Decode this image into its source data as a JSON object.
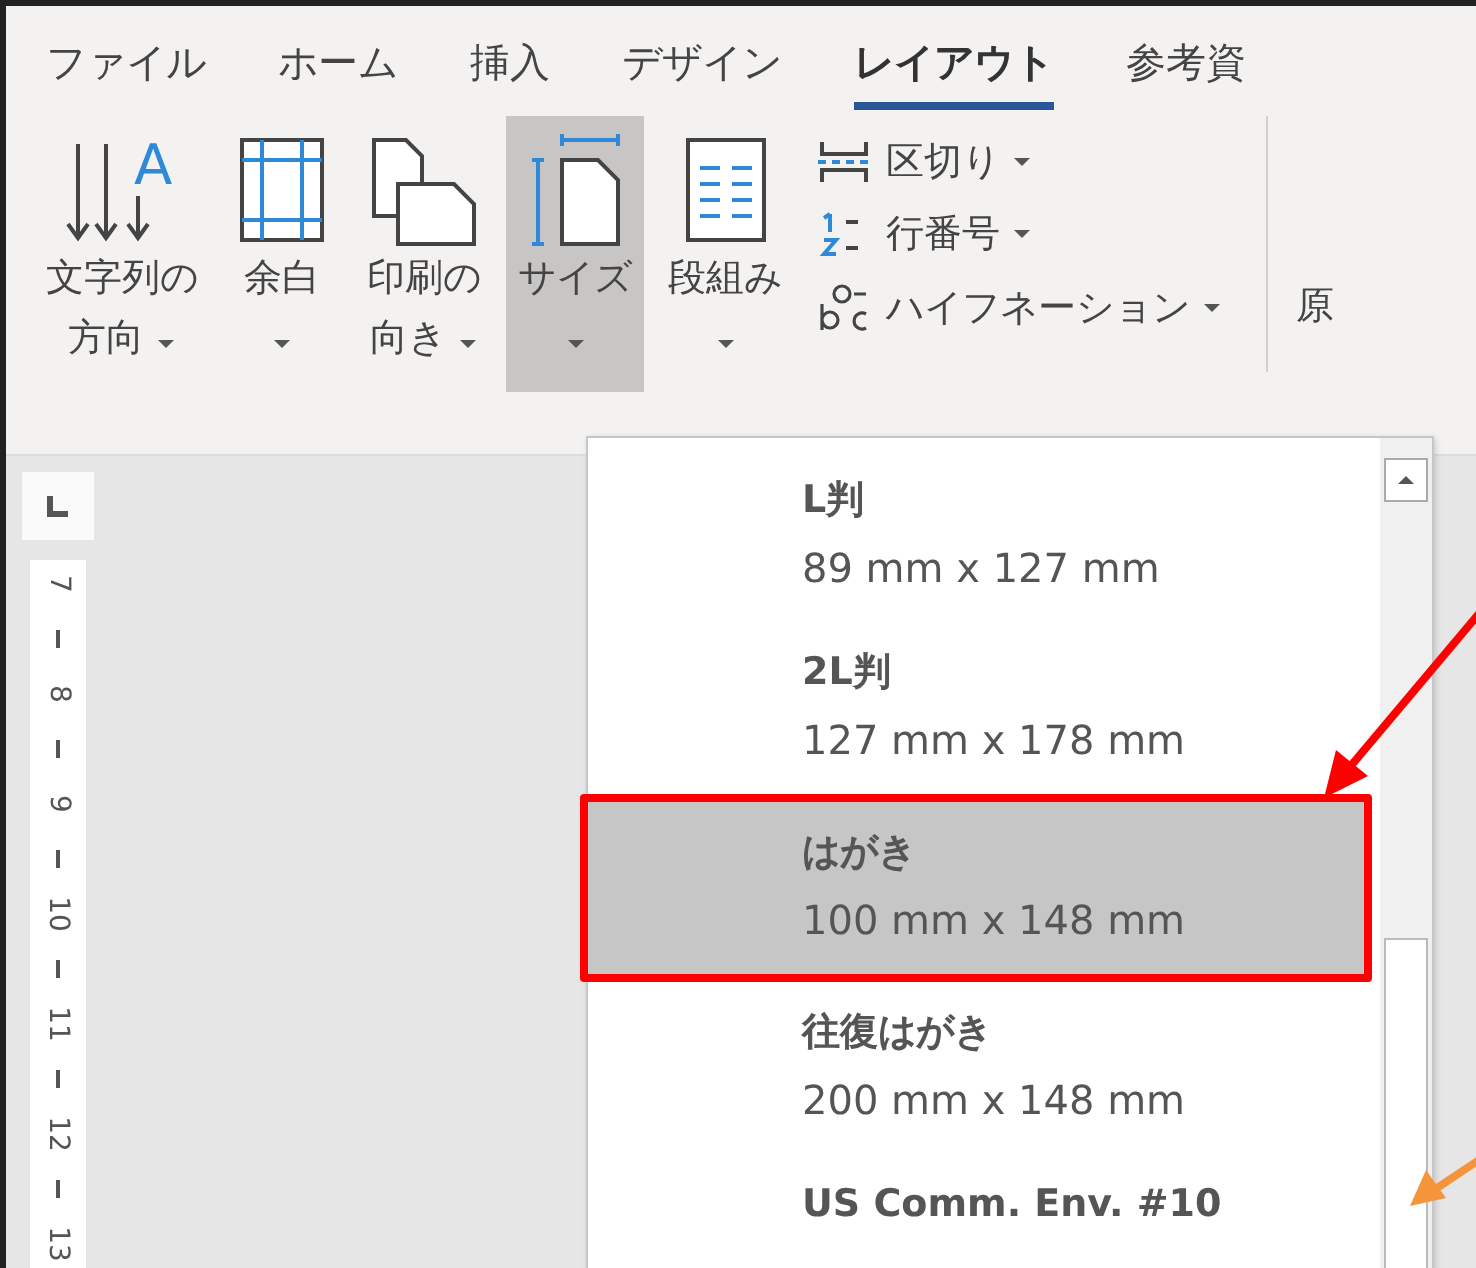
{
  "tabs": [
    {
      "label": "ファイル",
      "selected": false
    },
    {
      "label": "ホーム",
      "selected": false
    },
    {
      "label": "挿入",
      "selected": false
    },
    {
      "label": "デザイン",
      "selected": false
    },
    {
      "label": "レイアウト",
      "selected": true
    },
    {
      "label": "参考資",
      "selected": false
    }
  ],
  "ribbon": {
    "large_buttons": [
      {
        "kind": "text-direction",
        "icon_letter": "A",
        "lines": [
          "文字列の",
          "方向"
        ],
        "expanded": false
      },
      {
        "kind": "margins",
        "lines": [
          "余白"
        ],
        "expanded": false
      },
      {
        "kind": "orientation",
        "lines": [
          "印刷の",
          "向き"
        ],
        "expanded": false
      },
      {
        "kind": "size",
        "lines": [
          "サイズ"
        ],
        "expanded": true
      },
      {
        "kind": "columns",
        "lines": [
          "段組み"
        ],
        "expanded": false
      }
    ],
    "small_buttons": [
      {
        "kind": "breaks",
        "label": "区切り"
      },
      {
        "kind": "line-numbers",
        "label": "行番号"
      },
      {
        "kind": "hyphenation",
        "label": "ハイフネーション"
      }
    ],
    "next_group_label": "原"
  },
  "ruler": {
    "numbers": [
      "7",
      "8",
      "9",
      "10",
      "11",
      "12",
      "13"
    ]
  },
  "size_menu": {
    "items": [
      {
        "name": "L判",
        "dimensions": "89 mm x 127 mm",
        "selected": false
      },
      {
        "name": "2L判",
        "dimensions": "127 mm x 178 mm",
        "selected": false
      },
      {
        "name": "はがき",
        "dimensions": "100 mm x 148 mm",
        "selected": true
      },
      {
        "name": "往復はがき",
        "dimensions": "200 mm x 148 mm",
        "selected": false
      },
      {
        "name": "US Comm. Env. #10",
        "selected": false
      }
    ]
  }
}
